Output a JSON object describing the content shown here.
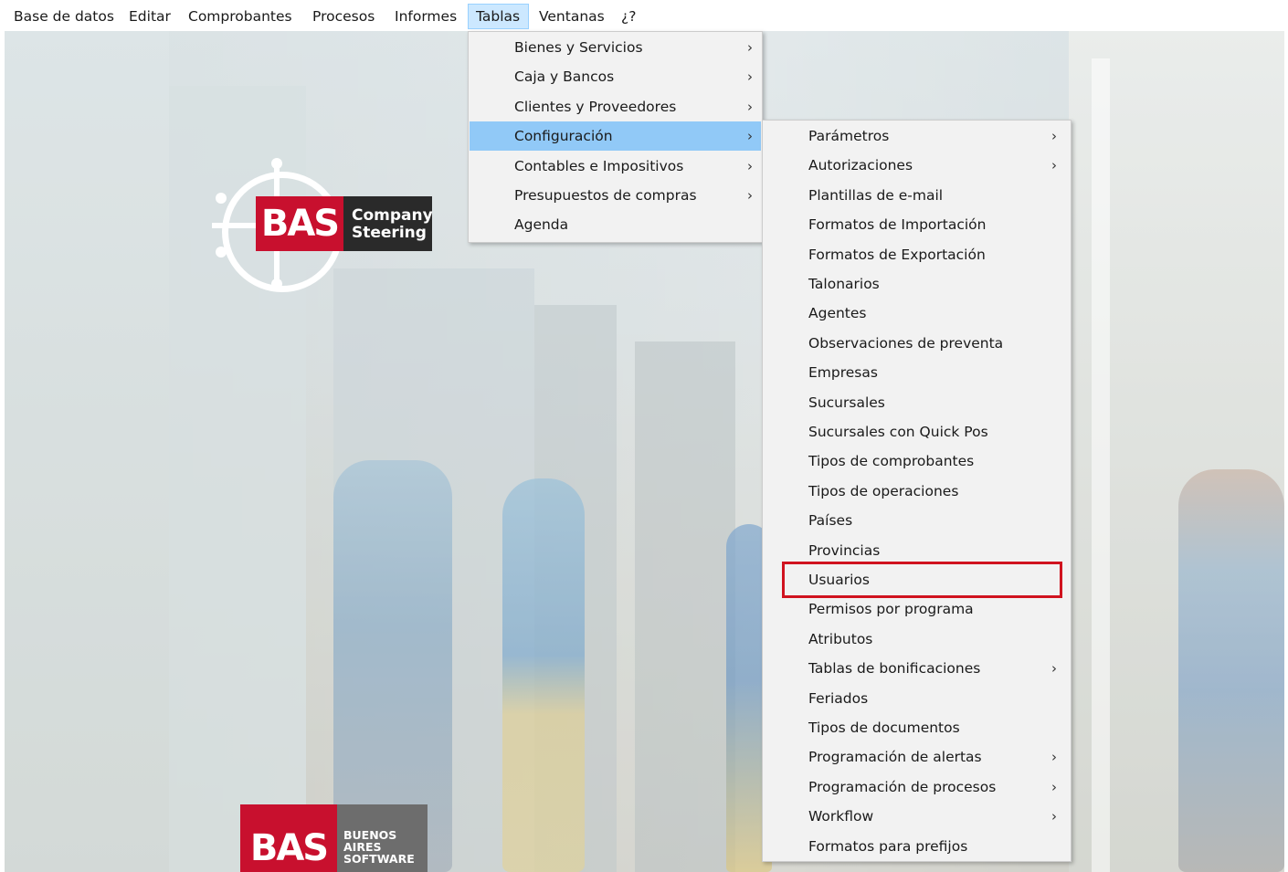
{
  "menubar": {
    "items": [
      {
        "label": "Base de datos"
      },
      {
        "label": "Editar"
      },
      {
        "label": "Comprobantes"
      },
      {
        "label": "Procesos"
      },
      {
        "label": "Informes"
      },
      {
        "label": "Tablas"
      },
      {
        "label": "Ventanas"
      },
      {
        "label": "¿?"
      }
    ],
    "open_item": "Tablas"
  },
  "tablas_menu": {
    "items": [
      {
        "label": "Bienes y Servicios",
        "submenu": true
      },
      {
        "label": "Caja y Bancos",
        "submenu": true
      },
      {
        "label": "Clientes y Proveedores",
        "submenu": true
      },
      {
        "label": "Configuración",
        "submenu": true,
        "highlighted": true
      },
      {
        "label": "Contables e Impositivos",
        "submenu": true
      },
      {
        "label": "Presupuestos de compras",
        "submenu": true
      },
      {
        "label": "Agenda",
        "submenu": false
      }
    ]
  },
  "configuracion_menu": {
    "items": [
      {
        "label": "Parámetros",
        "submenu": true
      },
      {
        "label": "Autorizaciones",
        "submenu": true
      },
      {
        "label": "Plantillas de e-mail",
        "submenu": false
      },
      {
        "label": "Formatos de Importación",
        "submenu": false
      },
      {
        "label": "Formatos de Exportación",
        "submenu": false
      },
      {
        "label": "Talonarios",
        "submenu": false
      },
      {
        "label": "Agentes",
        "submenu": false
      },
      {
        "label": "Observaciones de preventa",
        "submenu": false
      },
      {
        "label": "Empresas",
        "submenu": false
      },
      {
        "label": "Sucursales",
        "submenu": false
      },
      {
        "label": "Sucursales con Quick Pos",
        "submenu": false
      },
      {
        "label": "Tipos de comprobantes",
        "submenu": false
      },
      {
        "label": "Tipos de operaciones",
        "submenu": false
      },
      {
        "label": "Países",
        "submenu": false
      },
      {
        "label": "Provincias",
        "submenu": false
      },
      {
        "label": "Usuarios",
        "submenu": false,
        "annotated": true
      },
      {
        "label": "Permisos por programa",
        "submenu": false
      },
      {
        "label": "Atributos",
        "submenu": false
      },
      {
        "label": "Tablas de bonificaciones",
        "submenu": true
      },
      {
        "label": "Feriados",
        "submenu": false
      },
      {
        "label": "Tipos de documentos",
        "submenu": false
      },
      {
        "label": "Programación de alertas",
        "submenu": true
      },
      {
        "label": "Programación de procesos",
        "submenu": true
      },
      {
        "label": "Workflow",
        "submenu": true
      },
      {
        "label": "Formatos para prefijos",
        "submenu": false
      }
    ]
  },
  "logo": {
    "mark": "BAS",
    "line1": "Company",
    "line2": "Steering"
  },
  "footer_logo": {
    "mark": "BAS",
    "line1": "BUENOS",
    "line2": "AIRES",
    "line3": "SOFTWARE"
  },
  "icons": {
    "submenu_arrow": "chevron-right-icon"
  },
  "colors": {
    "menu_highlight": "#91c9f7",
    "menubar_open": "#cce8ff",
    "annotation_box": "#d0131f",
    "brand_red": "#c8102e"
  }
}
